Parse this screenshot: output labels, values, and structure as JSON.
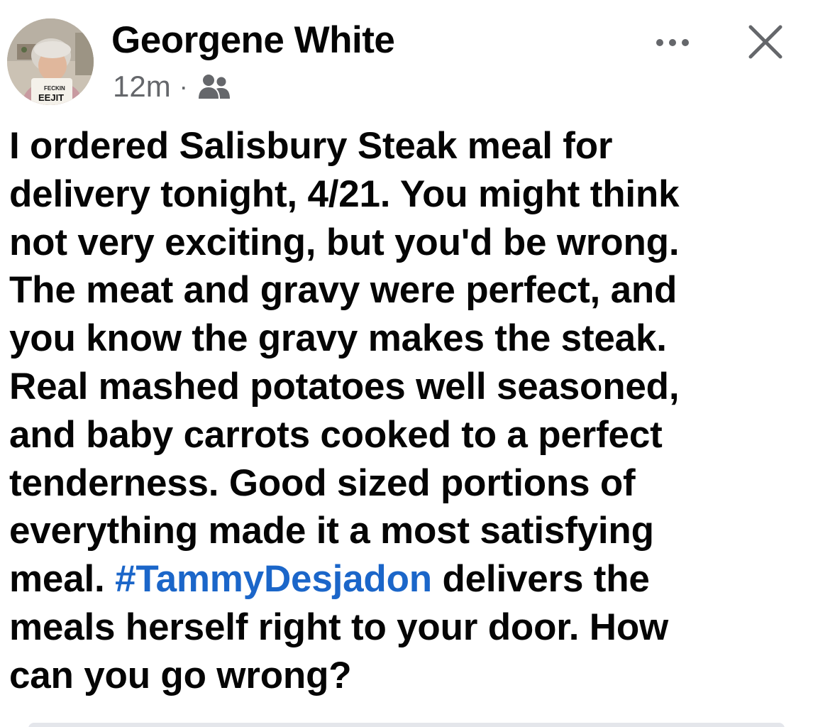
{
  "post": {
    "author": {
      "name": "Georgene White",
      "avatar_icon": "profile-photo",
      "mug_text_line1": "FECKIN",
      "mug_text_line2": "EEJIT"
    },
    "meta": {
      "timestamp": "12m",
      "separator": "·",
      "audience_icon": "group-icon"
    },
    "actions": {
      "more_icon": "more-horizontal-icon",
      "close_icon": "close-icon"
    },
    "body": {
      "line1": "I ordered Salisbury Steak meal for",
      "line2": "delivery tonight, 4/21. You might think",
      "line3": "not very exciting, but you'd be wrong.",
      "line4": "The meat and gravy were perfect, and",
      "line5": "you know the gravy makes the steak.",
      "line6": "Real mashed potatoes well seasoned,",
      "line7": "and baby carrots cooked to a perfect",
      "line8": "tenderness. Good sized portions of",
      "line9": "everything made it a most satisfying",
      "line10_before": "meal. ",
      "hashtag": "#TammyDesjadon",
      "line10_after": " delivers the",
      "line11": "meals herself right to your door. How",
      "line12": "can you go wrong?"
    },
    "colors": {
      "text": "#050505",
      "meta": "#65676b",
      "hashtag": "#1b66c9"
    }
  }
}
